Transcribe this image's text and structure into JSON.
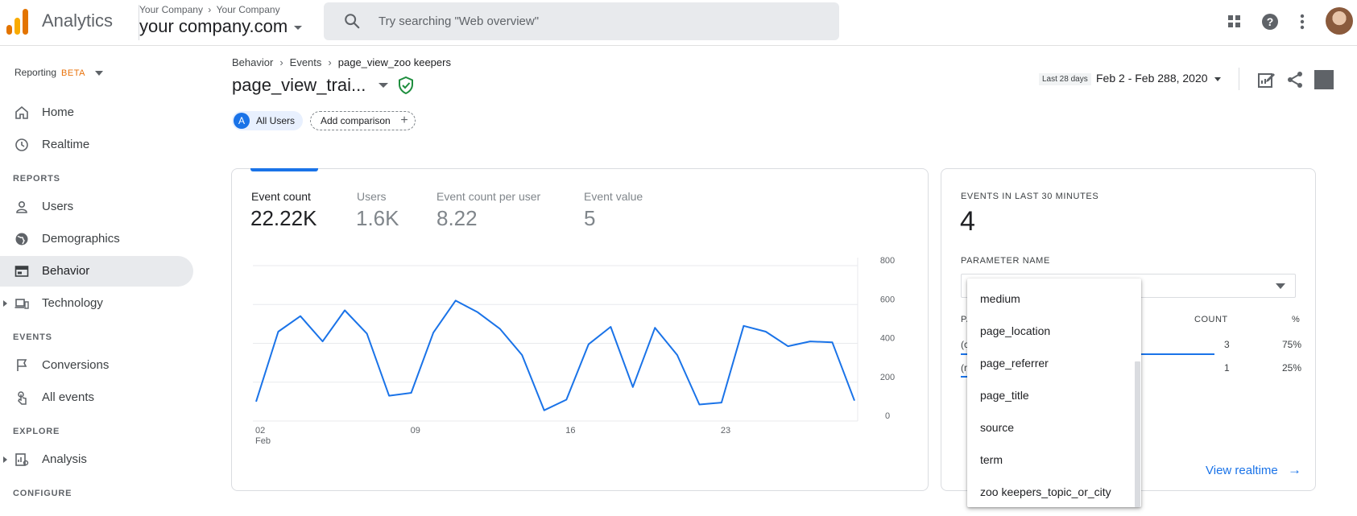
{
  "app": {
    "title": "Analytics"
  },
  "account": {
    "crumb": [
      "Your Company",
      "Your Company"
    ],
    "property": "your company.com"
  },
  "search": {
    "placeholder": "Try searching \"Web overview\""
  },
  "sidebar": {
    "reporting": "Reporting",
    "beta": "BETA",
    "items": [
      {
        "label": "Home",
        "icon": "home-icon"
      },
      {
        "label": "Realtime",
        "icon": "clock-icon"
      },
      {
        "label": "Users",
        "icon": "person-icon"
      },
      {
        "label": "Demographics",
        "icon": "globe-icon"
      },
      {
        "label": "Behavior",
        "icon": "behavior-icon",
        "active": true
      },
      {
        "label": "Technology",
        "icon": "devices-icon"
      },
      {
        "label": "Conversions",
        "icon": "flag-icon"
      },
      {
        "label": "All events",
        "icon": "touch-icon"
      },
      {
        "label": "Analysis",
        "icon": "analysis-icon"
      }
    ],
    "sections": {
      "reports": "REPORTS",
      "events": "EVENTS",
      "explore": "EXPLORE",
      "configure": "CONFIGURE"
    }
  },
  "breadcrumb": [
    "Behavior",
    "Events",
    "page_view_zoo keepers"
  ],
  "page_title": "page_view_trai...",
  "comparison": {
    "all_users_badge": "A",
    "all_users": "All Users",
    "add": "Add comparison",
    "add_icon": "+"
  },
  "date": {
    "label": "Last 28 days",
    "range": "Feb 2 - Feb 288, 2020"
  },
  "metrics": [
    {
      "label": "Event count",
      "value": "22.22K",
      "active": true
    },
    {
      "label": "Users",
      "value": "1.6K"
    },
    {
      "label": "Event count per user",
      "value": "8.22"
    },
    {
      "label": "Event value",
      "value": "5"
    }
  ],
  "chart_data": {
    "type": "line",
    "x": [
      2,
      3,
      4,
      5,
      6,
      7,
      8,
      9,
      10,
      11,
      12,
      13,
      14,
      15,
      16,
      17,
      18,
      19,
      20,
      21,
      22,
      23,
      24,
      25,
      26,
      27,
      28,
      29
    ],
    "x_ticks": [
      {
        "value": 2,
        "label": "02",
        "sub": "Feb"
      },
      {
        "value": 9,
        "label": "09"
      },
      {
        "value": 16,
        "label": "16"
      },
      {
        "value": 23,
        "label": "23"
      }
    ],
    "series": [
      {
        "values": [
          100,
          460,
          540,
          410,
          570,
          450,
          130,
          145,
          455,
          620,
          560,
          475,
          340,
          55,
          110,
          395,
          485,
          175,
          480,
          340,
          85,
          95,
          490,
          460,
          385,
          410,
          405,
          105
        ],
        "color": "#1a73e8"
      }
    ],
    "yticks": [
      0,
      200,
      400,
      600,
      800
    ],
    "ylim": [
      0,
      800
    ],
    "grid": true
  },
  "realtime": {
    "title": "EVENTS IN LAST 30 MINUTES",
    "value": "4",
    "param_label": "PARAMETER NAME",
    "headers": {
      "param": "PA",
      "count": "COUNT",
      "pct": "%"
    },
    "rows": [
      {
        "param": "(c",
        "count": "3",
        "pct": "75%",
        "share": 0.75
      },
      {
        "param": "(n",
        "count": "1",
        "pct": "25%",
        "share": 0.25
      }
    ],
    "view_link": "View realtime",
    "view_icon": "→"
  },
  "dropdown": {
    "options": [
      "medium",
      "page_location",
      "page_referrer",
      "page_title",
      "source",
      "term",
      "zoo keepers_topic_or_city"
    ]
  }
}
